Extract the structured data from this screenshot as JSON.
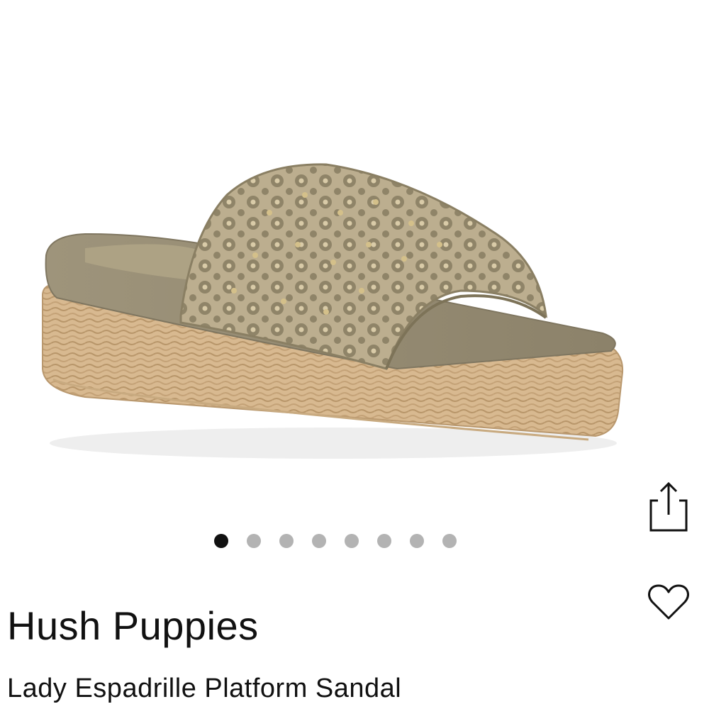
{
  "product": {
    "brand": "Hush Puppies",
    "name": "Lady Espadrille Platform Sandal",
    "image": "gold-laser-cut-slide-sandal-with-espadrille-platform"
  },
  "gallery": {
    "image_count": 8,
    "active_index": 0
  },
  "actions": {
    "share_icon": "share-icon",
    "favorite_icon": "heart-icon"
  },
  "colors": {
    "text": "#111111",
    "dot_active": "#111111",
    "dot_inactive": "#b3b3b3",
    "upper": "#b7aa8c",
    "jute": "#d9bb92"
  }
}
